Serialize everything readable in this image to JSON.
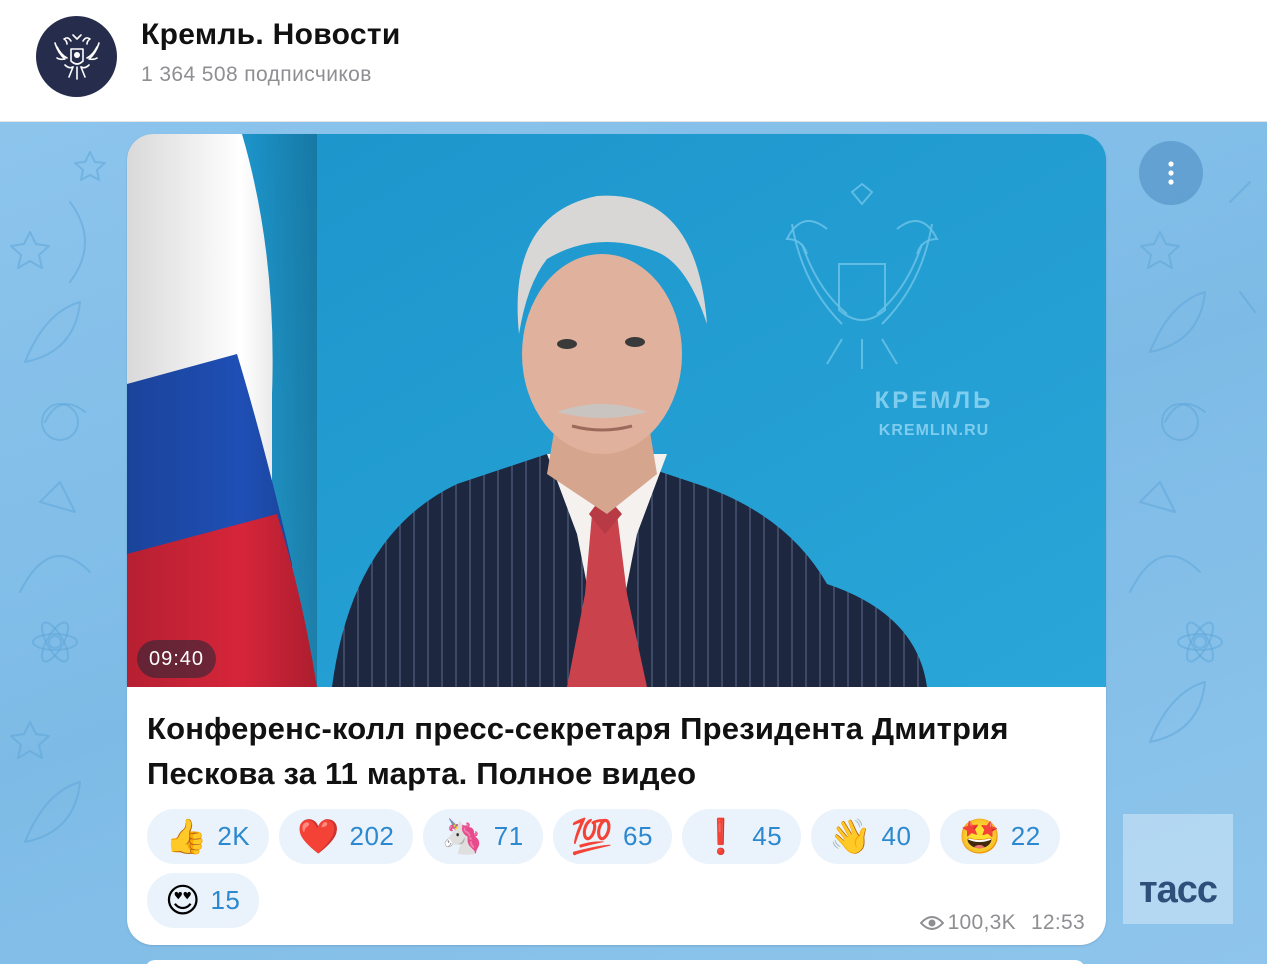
{
  "channel": {
    "title": "Кремль. Новости",
    "subscribers": "1 364 508 подписчиков",
    "avatar_icon": "russian-eagle-emblem-icon"
  },
  "post": {
    "video": {
      "duration": "09:40",
      "backdrop_title": "КРЕМЛЬ",
      "backdrop_url": "KREMLIN.RU"
    },
    "title": "Конференс-колл пресс-секретаря Президента Дмитрия Пескова за 11 марта. Полное видео",
    "reactions": [
      {
        "emoji": "👍",
        "count": "2K"
      },
      {
        "emoji": "❤️",
        "count": "202"
      },
      {
        "emoji": "🦄",
        "count": "71"
      },
      {
        "emoji": "💯",
        "count": "65"
      },
      {
        "emoji": "❗",
        "count": "45"
      },
      {
        "emoji": "👋",
        "count": "40"
      },
      {
        "emoji": "🤩",
        "count": "22"
      },
      {
        "emoji": "😍",
        "count": "15"
      }
    ],
    "views": "100,3K",
    "time": "12:53"
  },
  "watermark": "тасс",
  "colors": {
    "chat_background": "#8cc4ec",
    "reaction_bg": "#eaf3fb",
    "reaction_text": "#2c89cf",
    "avatar_bg": "#262c4b"
  }
}
